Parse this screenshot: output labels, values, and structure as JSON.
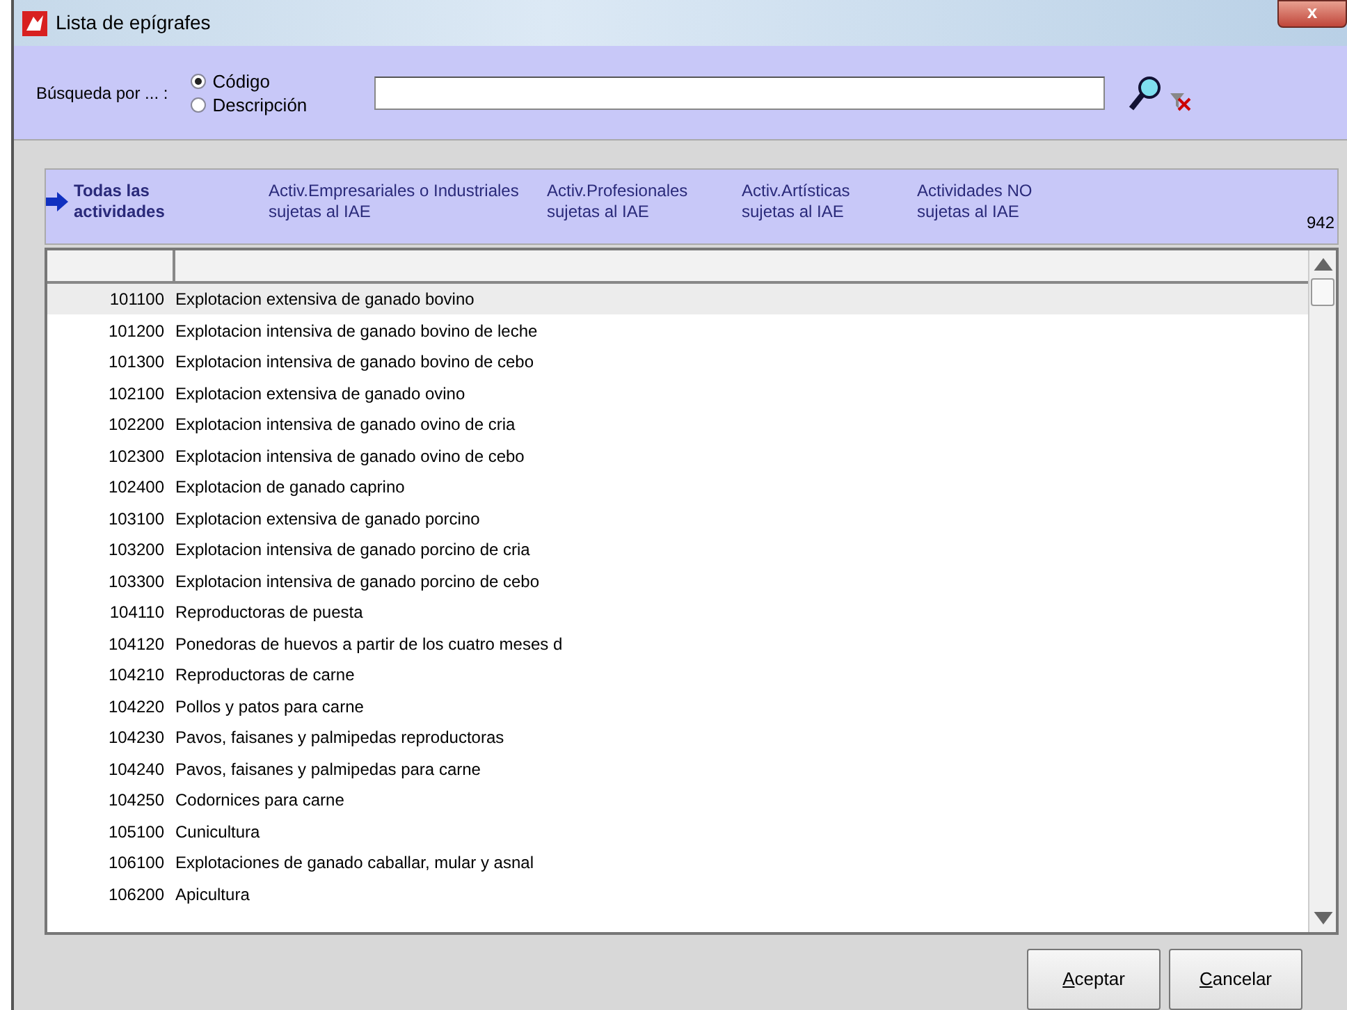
{
  "window": {
    "title": "Lista de epígrafes",
    "close": "x"
  },
  "search": {
    "label": "Búsqueda por ... :",
    "options": [
      {
        "label": "Código",
        "selected": true
      },
      {
        "label": "Descripción",
        "selected": false
      }
    ]
  },
  "filters": [
    {
      "label": "Todas las actividades",
      "selected": true
    },
    {
      "label": "Activ.Empresariales o Industriales sujetas al IAE",
      "selected": false
    },
    {
      "label": "Activ.Profesionales sujetas al IAE",
      "selected": false
    },
    {
      "label": "Activ.Artísticas sujetas al IAE",
      "selected": false
    },
    {
      "label": "Actividades NO sujetas al IAE",
      "selected": false
    }
  ],
  "count": "942",
  "table": {
    "rows": [
      {
        "code": "101100",
        "description": "Explotacion extensiva de ganado bovino",
        "selected": true
      },
      {
        "code": "101200",
        "description": "Explotacion intensiva de ganado bovino de leche",
        "selected": false
      },
      {
        "code": "101300",
        "description": "Explotacion intensiva de ganado bovino de cebo",
        "selected": false
      },
      {
        "code": "102100",
        "description": "Explotacion extensiva de ganado ovino",
        "selected": false
      },
      {
        "code": "102200",
        "description": "Explotacion intensiva de ganado ovino de cria",
        "selected": false
      },
      {
        "code": "102300",
        "description": "Explotacion intensiva de ganado ovino de cebo",
        "selected": false
      },
      {
        "code": "102400",
        "description": "Explotacion de ganado caprino",
        "selected": false
      },
      {
        "code": "103100",
        "description": "Explotacion extensiva de ganado porcino",
        "selected": false
      },
      {
        "code": "103200",
        "description": "Explotacion intensiva de ganado porcino de cria",
        "selected": false
      },
      {
        "code": "103300",
        "description": "Explotacion intensiva de ganado porcino de cebo",
        "selected": false
      },
      {
        "code": "104110",
        "description": "Reproductoras de puesta",
        "selected": false
      },
      {
        "code": "104120",
        "description": "Ponedoras de huevos a partir de los cuatro meses d",
        "selected": false
      },
      {
        "code": "104210",
        "description": "Reproductoras de carne",
        "selected": false
      },
      {
        "code": "104220",
        "description": "Pollos y patos para carne",
        "selected": false
      },
      {
        "code": "104230",
        "description": "Pavos, faisanes y palmipedas reproductoras",
        "selected": false
      },
      {
        "code": "104240",
        "description": "Pavos, faisanes y palmipedas para carne",
        "selected": false
      },
      {
        "code": "104250",
        "description": "Codornices para carne",
        "selected": false
      },
      {
        "code": "105100",
        "description": "Cunicultura",
        "selected": false
      },
      {
        "code": "106100",
        "description": "Explotaciones de ganado caballar, mular y asnal",
        "selected": false
      },
      {
        "code": "106200",
        "description": "Apicultura",
        "selected": false
      }
    ]
  },
  "buttons": [
    {
      "mnemonic": "A",
      "rest": "ceptar"
    },
    {
      "mnemonic": "C",
      "rest": "ancelar"
    }
  ]
}
